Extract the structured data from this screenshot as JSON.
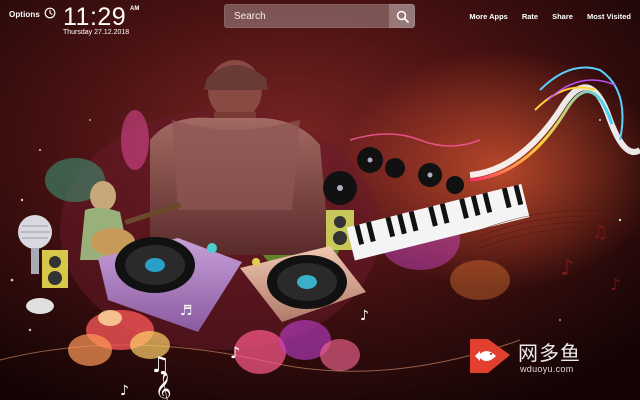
{
  "header": {
    "options_label": "Options",
    "time": "11:29",
    "ampm": "AM",
    "date": "Thursday  27.12.2018"
  },
  "search": {
    "placeholder": "Search"
  },
  "nav": {
    "items": [
      {
        "label": "More Apps"
      },
      {
        "label": "Rate"
      },
      {
        "label": "Share"
      },
      {
        "label": "Most Visited"
      }
    ]
  },
  "watermark": {
    "cn_text": "网多鱼",
    "en_text": "wduoyu.com"
  },
  "icons": [
    "clock-icon",
    "search-icon",
    "fish-logo-icon"
  ],
  "colors": {
    "background_dark": "#1a0606",
    "accent_red": "#e2402e"
  }
}
